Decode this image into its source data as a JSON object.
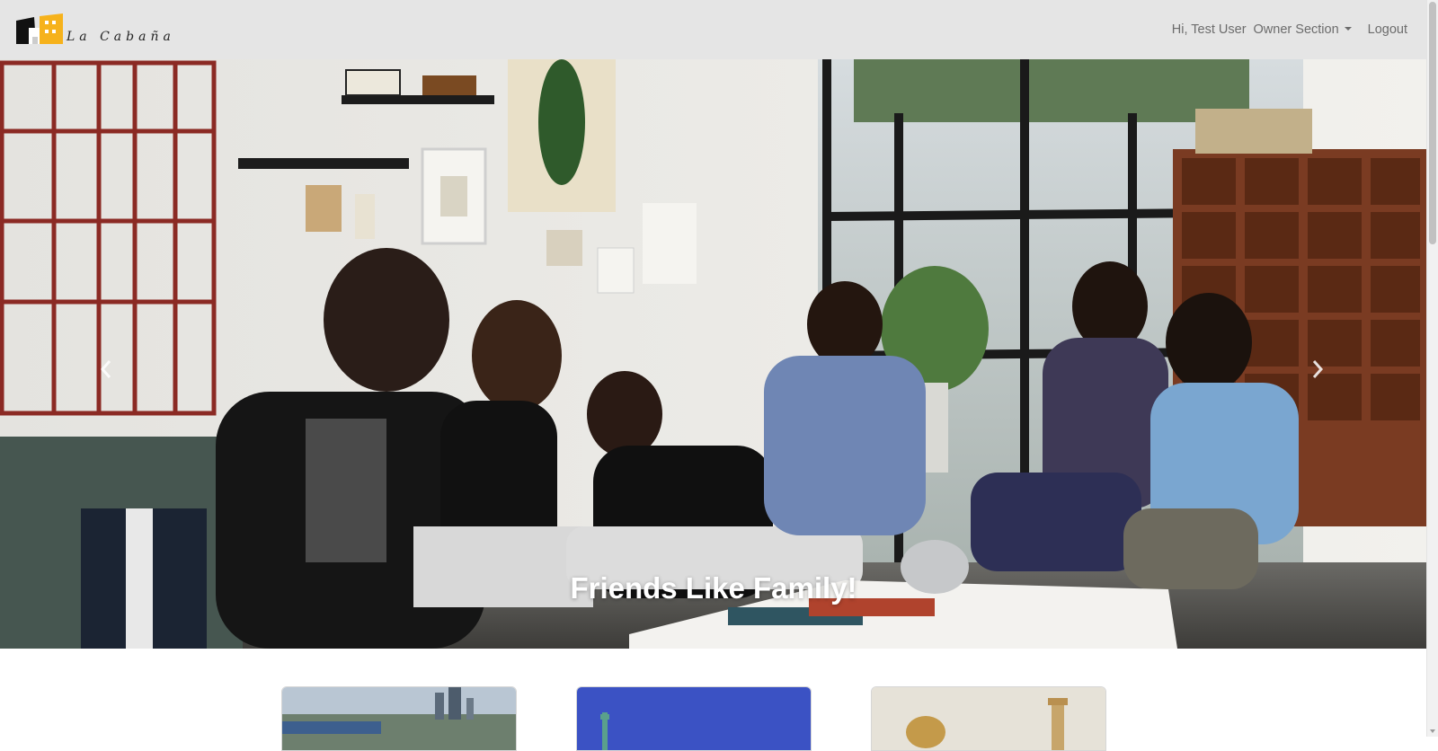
{
  "brand": {
    "name": "La Cabaña",
    "logo_icon": "house-logo-icon"
  },
  "nav": {
    "greeting": "Hi, Test User",
    "owner_section": "Owner Section",
    "logout": "Logout"
  },
  "hero": {
    "caption": "Friends Like Family!",
    "prev_icon": "chevron-left-icon",
    "next_icon": "chevron-right-icon"
  },
  "cards": [
    {
      "image": "city-river-photo"
    },
    {
      "image": "statue-of-liberty-photo"
    },
    {
      "image": "historic-monument-photo"
    }
  ],
  "colors": {
    "navbar_bg": "#e5e5e5",
    "nav_text": "#6c6c6c",
    "logo_yellow": "#f6b21b",
    "caption": "#ffffff"
  }
}
